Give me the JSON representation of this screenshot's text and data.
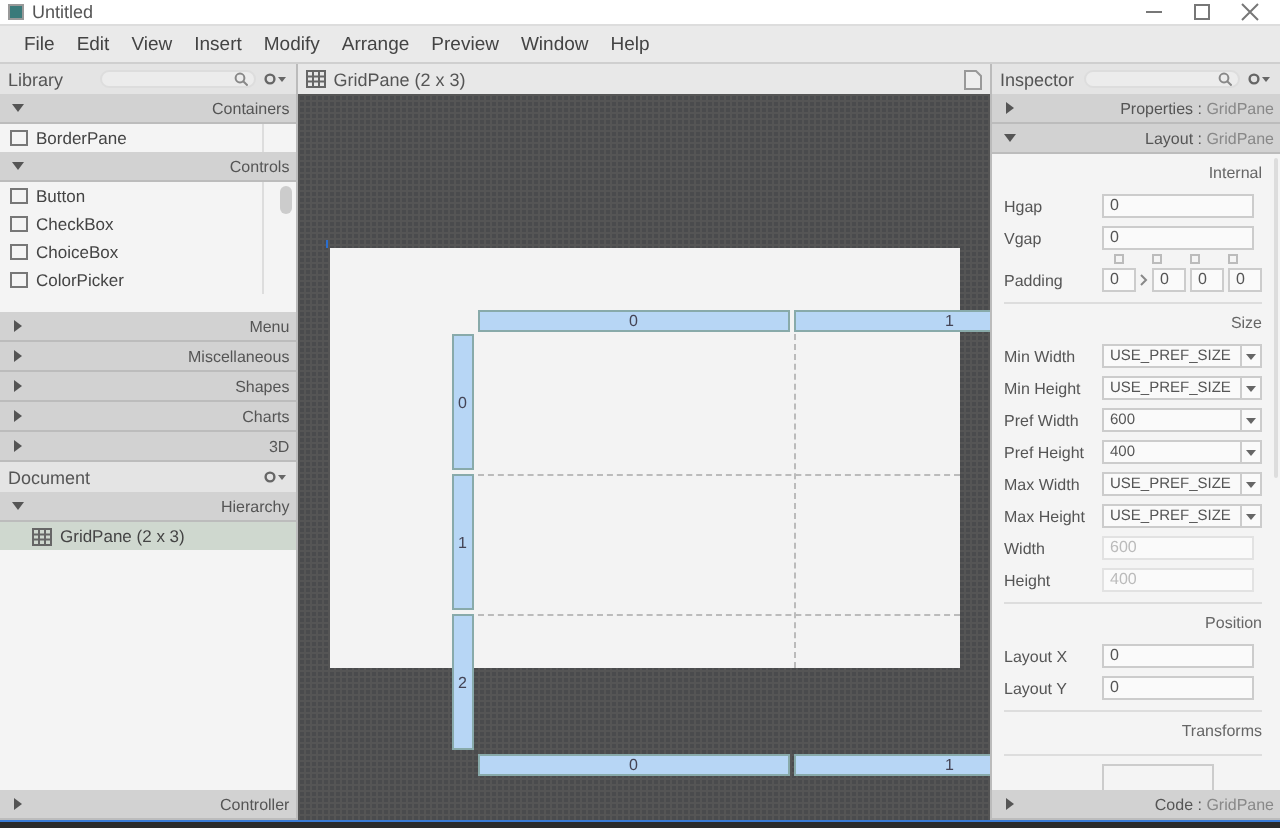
{
  "window": {
    "title": "Untitled"
  },
  "menu": [
    "File",
    "Edit",
    "View",
    "Insert",
    "Modify",
    "Arrange",
    "Preview",
    "Window",
    "Help"
  ],
  "library": {
    "title": "Library",
    "sections": [
      {
        "title": "Containers",
        "expanded": true,
        "items": [
          {
            "label": "BorderPane"
          }
        ]
      },
      {
        "title": "Controls",
        "expanded": true,
        "items": [
          {
            "label": "Button"
          },
          {
            "label": "CheckBox"
          },
          {
            "label": "ChoiceBox"
          },
          {
            "label": "ColorPicker"
          }
        ]
      },
      {
        "title": "Menu",
        "expanded": false
      },
      {
        "title": "Miscellaneous",
        "expanded": false
      },
      {
        "title": "Shapes",
        "expanded": false
      },
      {
        "title": "Charts",
        "expanded": false
      },
      {
        "title": "3D",
        "expanded": false
      }
    ]
  },
  "document": {
    "title": "Document",
    "sections": [
      {
        "title": "Hierarchy",
        "expanded": true,
        "items": [
          {
            "label": "GridPane (2 x 3)",
            "selected": true
          }
        ]
      },
      {
        "title": "Controller",
        "expanded": false
      }
    ]
  },
  "canvas": {
    "breadcrumb": "GridPane (2 x 3)",
    "columns": [
      "0",
      "1"
    ],
    "bottom_columns": [
      "0",
      "1"
    ],
    "rows": [
      "0",
      "1",
      "2"
    ]
  },
  "inspector": {
    "title": "Inspector",
    "panes": [
      {
        "title": "Properties :",
        "target": "GridPane",
        "expanded": false
      },
      {
        "title": "Layout :",
        "target": "GridPane",
        "expanded": true
      }
    ],
    "groups": [
      {
        "title": "Internal",
        "fields": [
          {
            "label": "Hgap",
            "kind": "text",
            "value": "0",
            "disabled": false
          },
          {
            "label": "Vgap",
            "kind": "text",
            "value": "0",
            "disabled": false
          },
          {
            "label": "Padding",
            "kind": "padding",
            "values": [
              "0",
              "0",
              "0",
              "0"
            ],
            "disabled": false
          }
        ]
      },
      {
        "title": "Size",
        "fields": [
          {
            "label": "Min Width",
            "kind": "combo",
            "value": "USE_PREF_SIZE",
            "disabled": false
          },
          {
            "label": "Min Height",
            "kind": "combo",
            "value": "USE_PREF_SIZE",
            "disabled": false
          },
          {
            "label": "Pref Width",
            "kind": "combo",
            "value": "600",
            "disabled": false
          },
          {
            "label": "Pref Height",
            "kind": "combo",
            "value": "400",
            "disabled": false
          },
          {
            "label": "Max Width",
            "kind": "combo",
            "value": "USE_PREF_SIZE",
            "disabled": false
          },
          {
            "label": "Max Height",
            "kind": "combo",
            "value": "USE_PREF_SIZE",
            "disabled": false
          },
          {
            "label": "Width",
            "kind": "text",
            "value": "600",
            "disabled": true
          },
          {
            "label": "Height",
            "kind": "text",
            "value": "400",
            "disabled": true
          }
        ]
      },
      {
        "title": "Position",
        "fields": [
          {
            "label": "Layout X",
            "kind": "text",
            "value": "0",
            "disabled": false
          },
          {
            "label": "Layout Y",
            "kind": "text",
            "value": "0",
            "disabled": false
          }
        ]
      },
      {
        "title": "Transforms"
      }
    ]
  },
  "code_pane": {
    "title": "Code :",
    "target": "GridPane",
    "expanded": false
  }
}
